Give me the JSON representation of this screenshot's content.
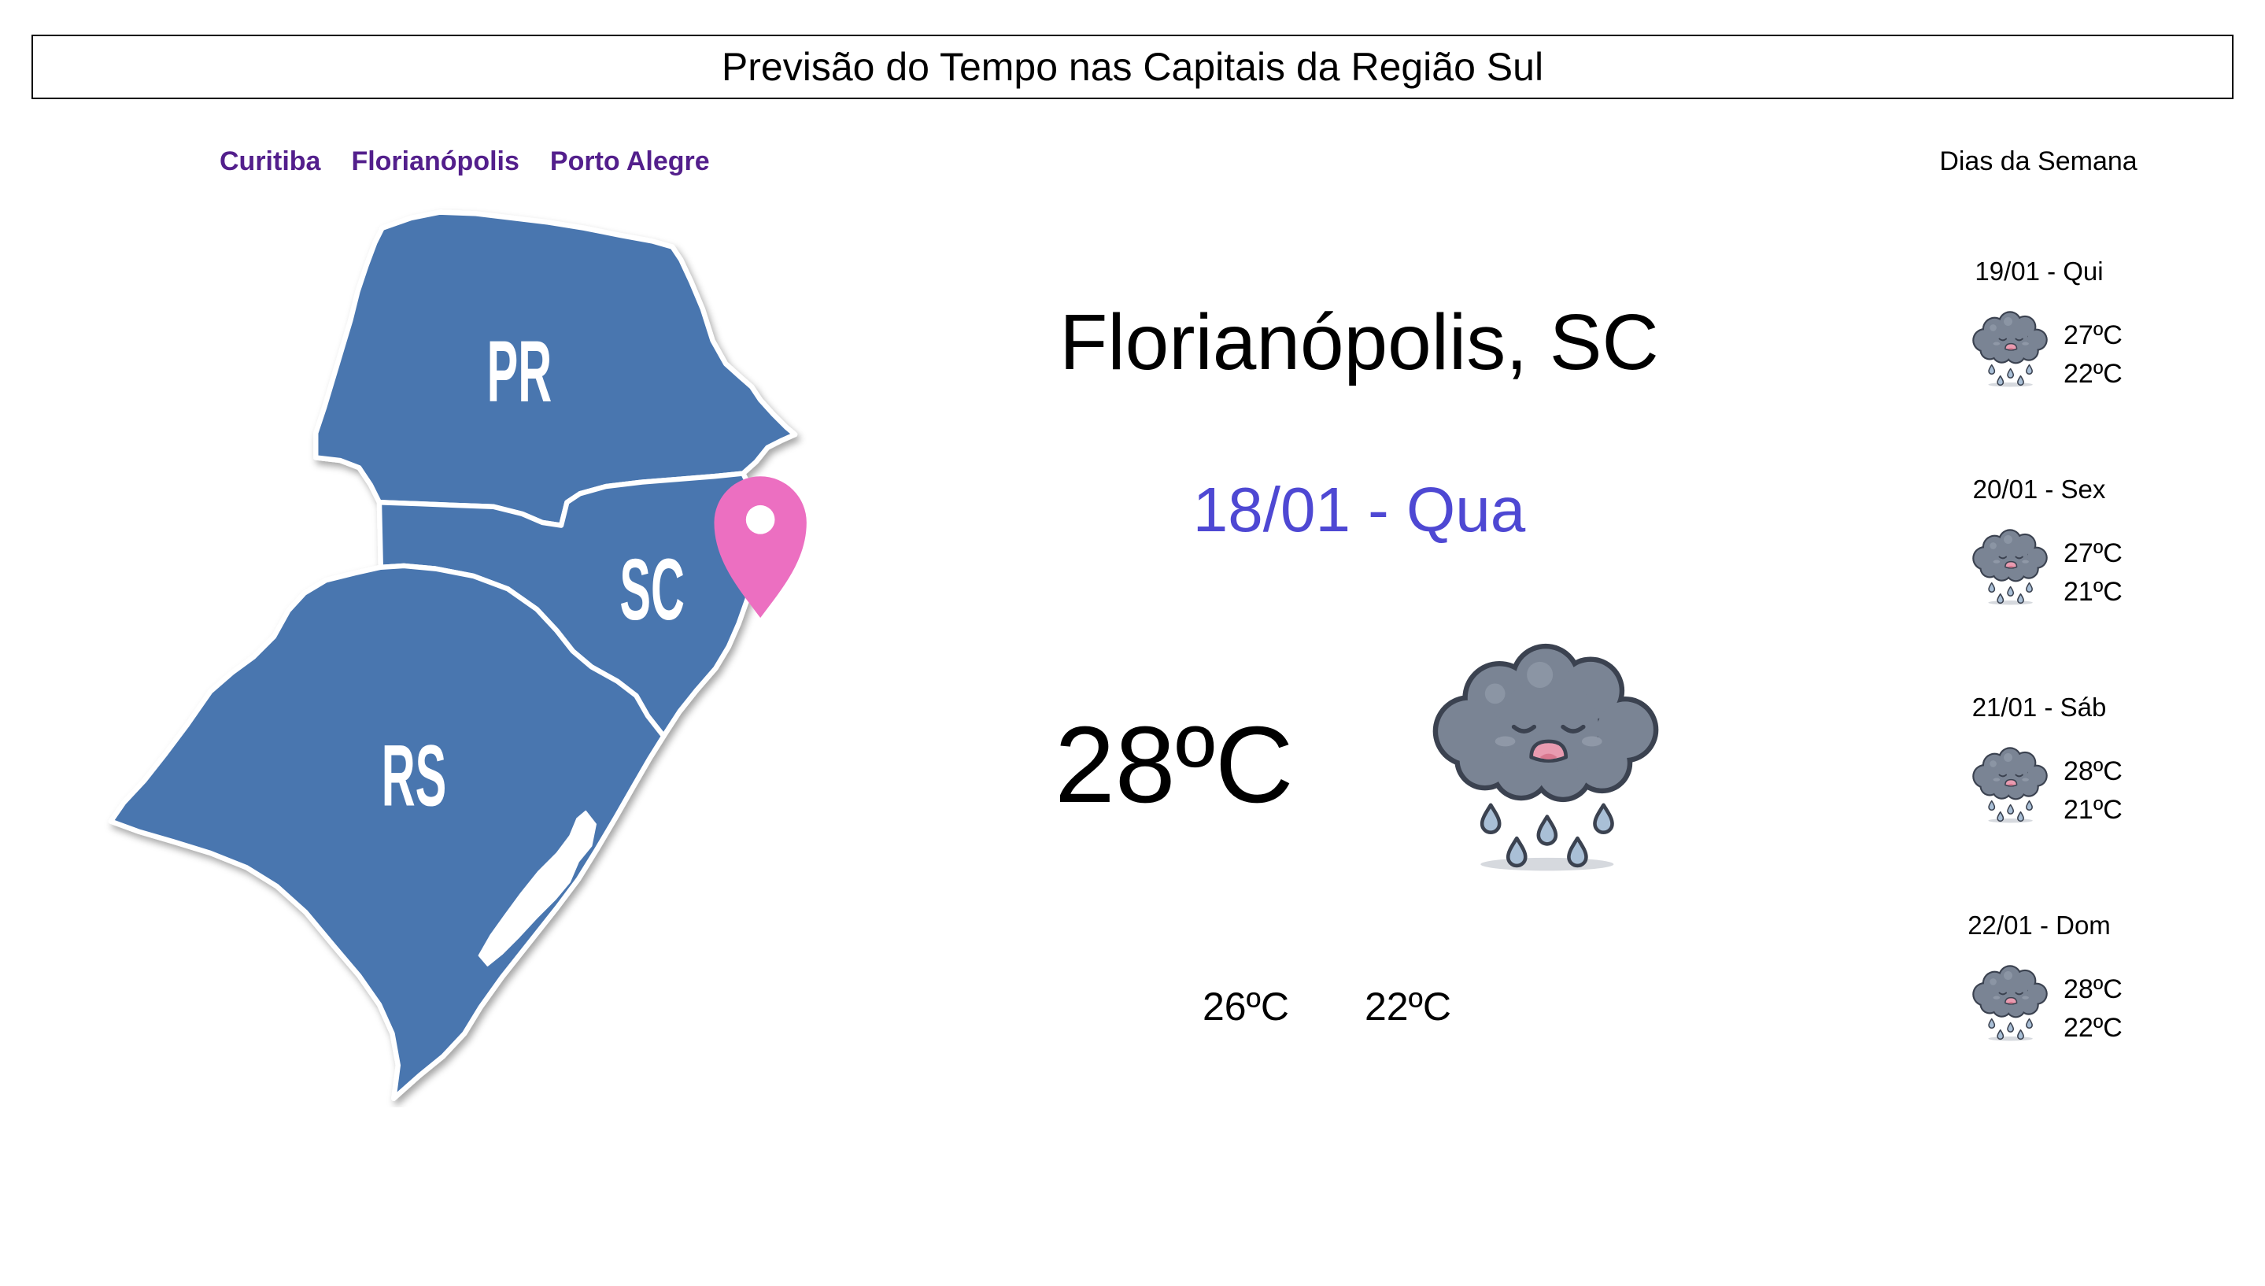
{
  "header": {
    "title": "Previsão do Tempo nas Capitais da Região Sul"
  },
  "nav": {
    "cities": [
      "Curitiba",
      "Florianópolis",
      "Porto Alegre"
    ]
  },
  "map": {
    "labels": [
      "PR",
      "SC",
      "RS"
    ],
    "pin_icon": "location-pin-icon"
  },
  "current": {
    "location": "Florianópolis, SC",
    "date": "18/01 - Qua",
    "temperature": "28ºC",
    "icon": "rain-cloud-icon",
    "temps": [
      "26ºC",
      "22ºC"
    ]
  },
  "week": {
    "heading": "Dias da Semana",
    "days": [
      {
        "date": "19/01 - Qui",
        "icon": "rain-cloud-icon",
        "temps": [
          "27ºC",
          "22ºC"
        ]
      },
      {
        "date": "20/01 - Sex",
        "icon": "rain-cloud-icon",
        "temps": [
          "27ºC",
          "21ºC"
        ]
      },
      {
        "date": "21/01 - Sáb",
        "icon": "rain-cloud-icon",
        "temps": [
          "28ºC",
          "21ºC"
        ]
      },
      {
        "date": "22/01 - Dom",
        "icon": "rain-cloud-icon",
        "temps": [
          "28ºC",
          "22ºC"
        ]
      }
    ]
  },
  "colors": {
    "link": "#531f8c",
    "date_text": "#4e48d3",
    "map_fill": "#4a76af",
    "pin": "#ec6fc1"
  }
}
